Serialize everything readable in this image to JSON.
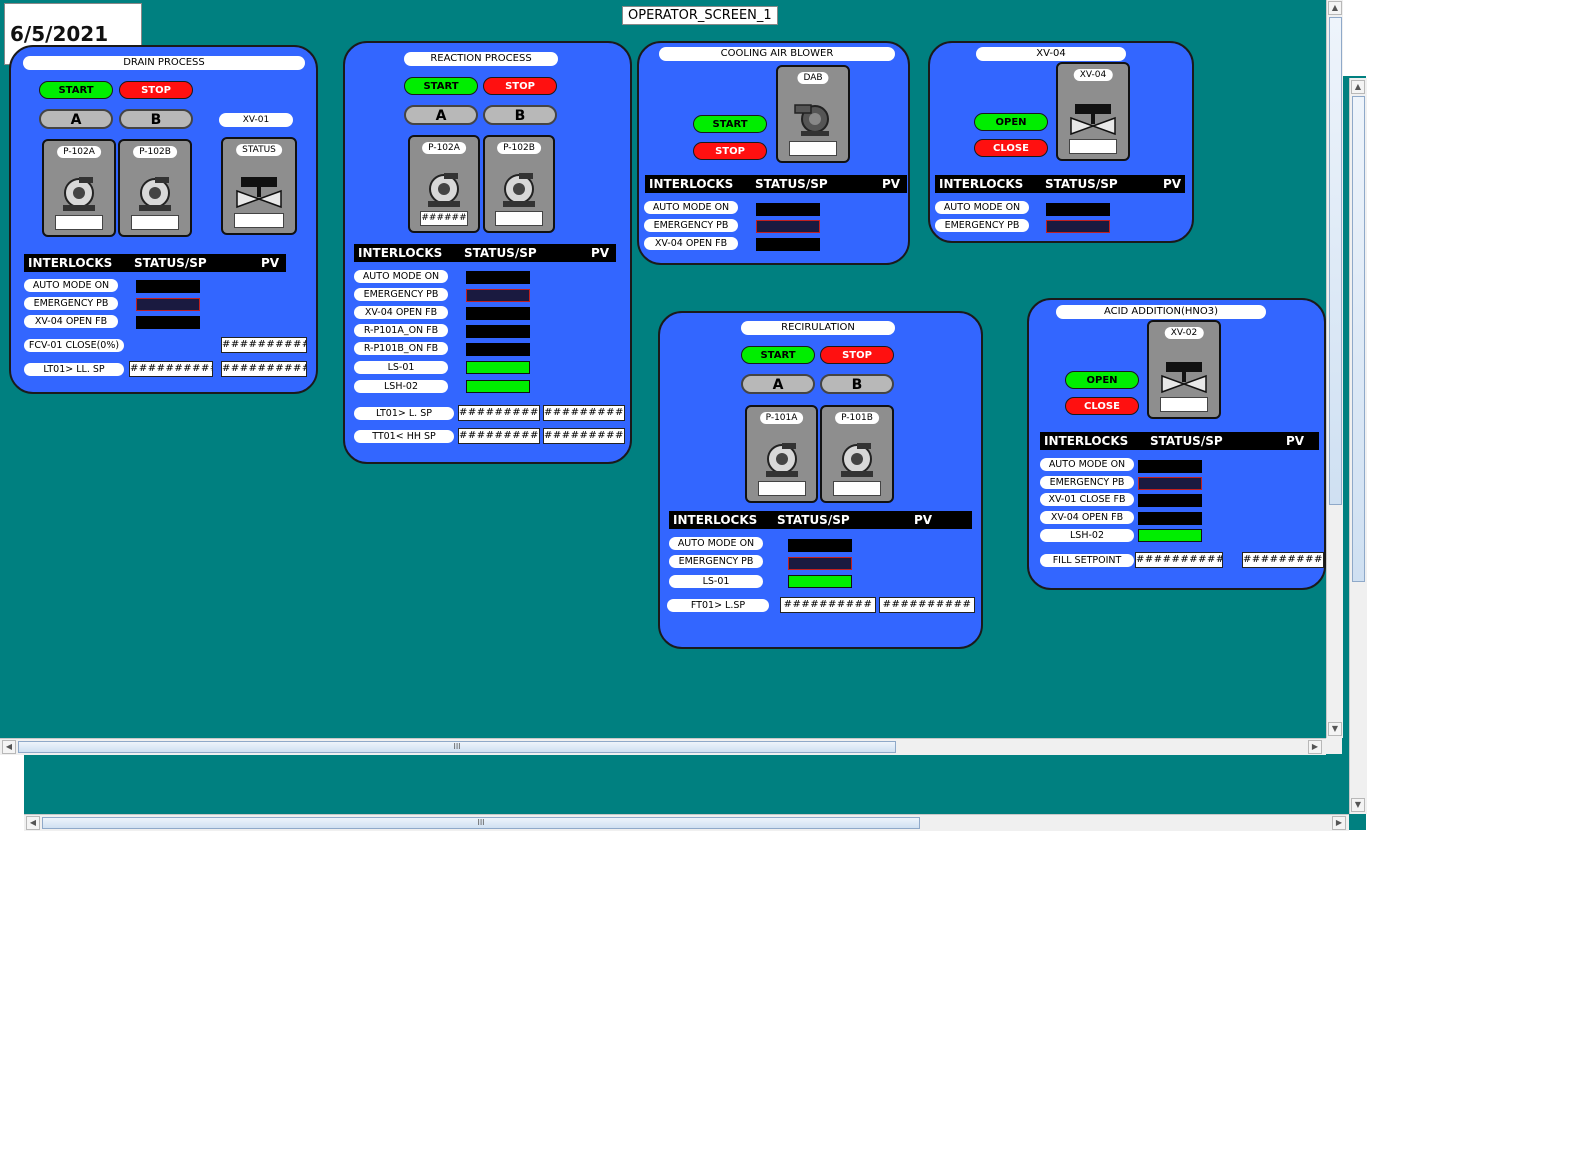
{
  "date": "6/5/2021",
  "screen_title": "OPERATOR_SCREEN_1",
  "scroll_thumb_glyph": "III",
  "colors": {
    "background": "#008080",
    "panel": "#3366ff",
    "start": "#00ee00",
    "stop": "#ff1010"
  },
  "common": {
    "start": "START",
    "stop": "STOP",
    "open": "OPEN",
    "close": "CLOSE",
    "a": "A",
    "b": "B",
    "hdr_interlocks": "INTERLOCKS",
    "hdr_status": "STATUS/SP",
    "hdr_pv": "PV"
  },
  "drain": {
    "title": "DRAIN PROCESS",
    "valve_tag": "XV-01",
    "pump_a": "P-102A",
    "pump_b": "P-102B",
    "status": "STATUS",
    "interlocks": [
      "AUTO MODE ON",
      "EMERGENCY PB",
      "XV-04 OPEN FB"
    ],
    "fcv_label": "FCV-01  CLOSE(0%)",
    "fcv_value": "##########",
    "lt_label": "LT01> LL. SP",
    "lt_sp": "##########",
    "lt_pv": "##########"
  },
  "reaction": {
    "title": "REACTION PROCESS",
    "pump_a": "P-102A",
    "pump_b": "P-102B",
    "pump_a_value": "######",
    "interlocks": [
      "AUTO MODE ON",
      "EMERGENCY PB",
      "XV-04 OPEN FB",
      "R-P101A_ON FB",
      "R-P101B_ON FB",
      "LS-01",
      "LSH-02"
    ],
    "lt_label": "LT01> L. SP",
    "lt_sp": "##########",
    "lt_pv": "##########",
    "tt_label": "TT01< HH SP",
    "tt_sp": "##########",
    "tt_pv": "##########"
  },
  "cooling": {
    "title": "COOLING AIR BLOWER",
    "equip": "DAB",
    "interlocks": [
      "AUTO MODE ON",
      "EMERGENCY PB",
      "XV-04 OPEN FB"
    ]
  },
  "xv04": {
    "title": "XV-04",
    "equip": "XV-04",
    "interlocks": [
      "AUTO MODE ON",
      "EMERGENCY PB"
    ]
  },
  "recirculation": {
    "title": "RECIRULATION",
    "pump_a": "P-101A",
    "pump_b": "P-101B",
    "interlocks": [
      "AUTO MODE ON",
      "EMERGENCY PB",
      "LS-01"
    ],
    "ft_label": "FT01> L.SP",
    "ft_sp": "##########",
    "ft_pv": "##########"
  },
  "acid": {
    "title": "ACID ADDITION(HNO3)",
    "equip": "XV-02",
    "interlocks": [
      "AUTO MODE ON",
      "EMERGENCY PB",
      "XV-01 CLOSE FB",
      "XV-04 OPEN FB",
      "LSH-02"
    ],
    "fill_label": "FILL SETPOINT",
    "fill_sp": "##########",
    "fill_pv": "##########"
  }
}
